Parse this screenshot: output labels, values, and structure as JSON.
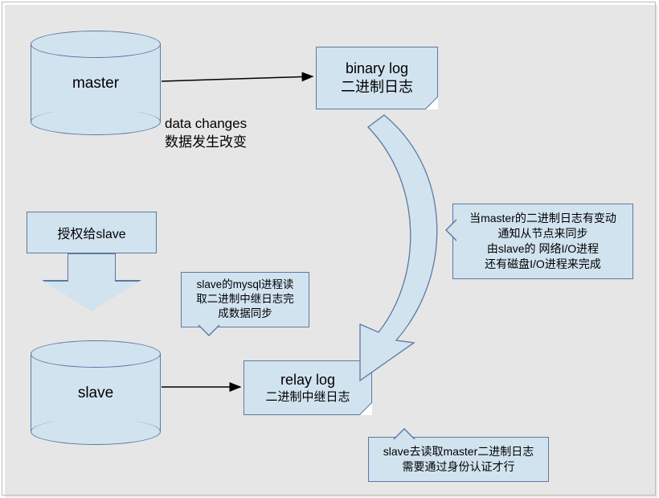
{
  "master_db": "master",
  "slave_db": "slave",
  "binlog": {
    "line1": "binary log",
    "line2": "二进制日志"
  },
  "relaylog": {
    "line1": "relay log",
    "line2": "二进制中继日志"
  },
  "auth_box": "授权给slave",
  "data_changes": {
    "line1": "data changes",
    "line2": "数据发生改变"
  },
  "callout_sync": {
    "l1": "当master的二进制日志有变动",
    "l2": "通知从节点来同步",
    "l3": "由slave的 网络I/O进程",
    "l4": "还有磁盘I/O进程来完成"
  },
  "callout_auth": {
    "l1": "slave去读取master二进制日志",
    "l2": "需要通过身份认证才行"
  },
  "callout_mysql": {
    "l1": "slave的mysql进程读",
    "l2": "取二进制中继日志完",
    "l3": "成数据同步"
  }
}
